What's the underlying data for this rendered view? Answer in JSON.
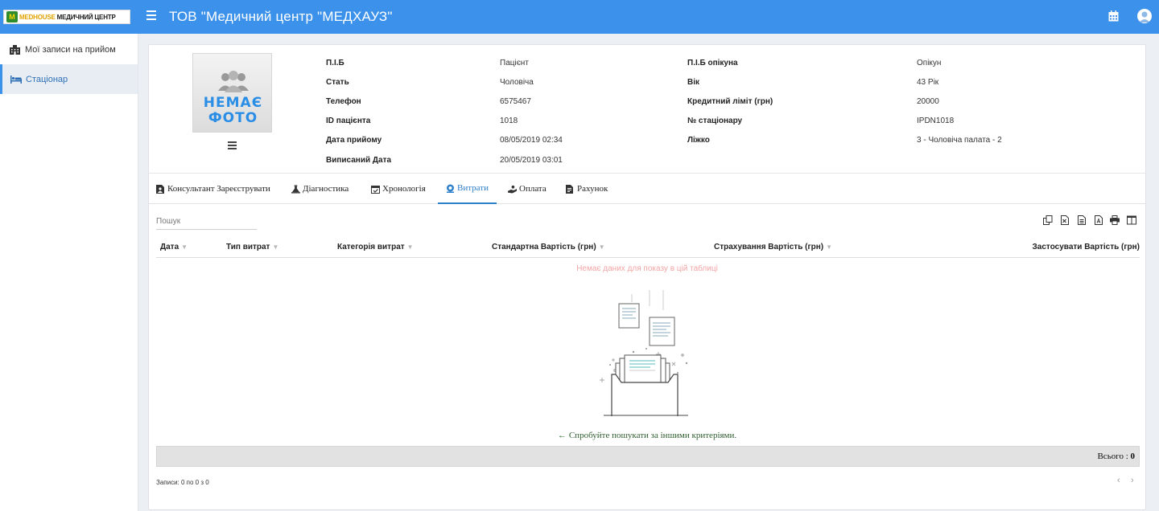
{
  "brand": {
    "logo_a": "MEDHOUSE",
    "logo_b": "МЕДИЧНИЙ ЦЕНТР"
  },
  "header": {
    "title": "ТОВ \"Медичний центр \"МЕДХАУЗ\""
  },
  "sidebar": {
    "items": [
      {
        "label": "Мої записи на прийом",
        "icon": "building-icon"
      },
      {
        "label": "Стаціонар",
        "icon": "bed-icon"
      }
    ]
  },
  "photo": {
    "line1": "НЕМАЄ",
    "line2": "ФОТО"
  },
  "patient": {
    "left": [
      {
        "label": "П.І.Б",
        "value": "Пацієнт"
      },
      {
        "label": "Стать",
        "value": "Чоловіча"
      },
      {
        "label": "Телефон",
        "value": "6575467"
      },
      {
        "label": "ID пацієнта",
        "value": "1018"
      },
      {
        "label": "Дата прийому",
        "value": "08/05/2019 02:34"
      },
      {
        "label": "Виписаний Дата",
        "value": "20/05/2019 03:01"
      }
    ],
    "right": [
      {
        "label": "П.І.Б опікуна",
        "value": "Опікун"
      },
      {
        "label": "Вік",
        "value": "43 Рік"
      },
      {
        "label": "Кредитний ліміт (грн)",
        "value": "20000"
      },
      {
        "label": "№ стаціонару",
        "value": "IPDN1018"
      },
      {
        "label": "Ліжко",
        "value": "3 - Чоловіча палата - 2"
      }
    ]
  },
  "tabs": [
    {
      "label": "Консультант Зареєструвати",
      "icon": "doc-user-icon"
    },
    {
      "label": "Діагностика",
      "icon": "flask-icon"
    },
    {
      "label": "Хронологія",
      "icon": "calendar-check-icon"
    },
    {
      "label": "Витрати",
      "icon": "coin-icon",
      "active": true
    },
    {
      "label": "Оплата",
      "icon": "hand-money-icon"
    },
    {
      "label": "Рахунок",
      "icon": "invoice-icon"
    }
  ],
  "table": {
    "search_placeholder": "Пошук",
    "columns": [
      "Дата",
      "Тип витрат",
      "Категорія витрат",
      "Стандартна Вартість (грн)",
      "Страхування Вартість (грн)",
      "Застосувати Вартість (грн)"
    ],
    "empty_message": "Немає даних для показу в цій таблиці",
    "hint": "Спробуйте пошукати за іншими критеріями.",
    "total_label": "Всього :",
    "total_value": "0",
    "records": "Записи: 0 по 0 з 0",
    "toolbar_icons": [
      "copy-icon",
      "excel-icon",
      "csv-icon",
      "pdf-icon",
      "print-icon",
      "columns-icon"
    ]
  },
  "colors": {
    "accent": "#3c92ea",
    "tab_active": "#2d7fc9",
    "empty_text": "#f2a5a5"
  }
}
